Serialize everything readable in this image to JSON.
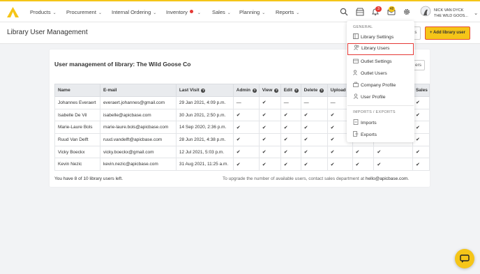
{
  "nav": {
    "items": [
      {
        "label": "Products"
      },
      {
        "label": "Procurement"
      },
      {
        "label": "Internal Ordering"
      },
      {
        "label": "Inventory"
      },
      {
        "label": "Sales"
      },
      {
        "label": "Planning"
      },
      {
        "label": "Reports"
      }
    ],
    "notifications_count": "3",
    "messages_count": "48",
    "user_name": "NICK VAN DYCK",
    "user_org": "THE WILD GOOS..."
  },
  "page": {
    "title": "Library User Management",
    "add_button": "+ Add library user",
    "card_title": "User management of library: The Wild Goose Co",
    "partial_button": "ers"
  },
  "table": {
    "headers": [
      "Name",
      "E-mail",
      "Last Visit",
      "Admin",
      "View",
      "Edit",
      "Delete",
      "Upload",
      "",
      "",
      "Sales"
    ],
    "rows": [
      {
        "name": "Johannes Everaert",
        "email": "everaert.johannes@gmail.com",
        "last_visit": "29 Jan 2021, 4:09 p.m.",
        "admin": "—",
        "view": "✔",
        "edit": "—",
        "delete": "—",
        "upload": "—",
        "c9": "",
        "c10": "",
        "sales": "✔"
      },
      {
        "name": "Isabelle De Vil",
        "email": "isabelle@apicbase.com",
        "last_visit": "30 Jun 2021, 2:50 p.m.",
        "admin": "✔",
        "view": "✔",
        "edit": "✔",
        "delete": "✔",
        "upload": "✔",
        "c9": "",
        "c10": "",
        "sales": "✔"
      },
      {
        "name": "Marie-Laure Bols",
        "email": "marie-laure.bols@apicbase.com",
        "last_visit": "14 Sep 2020, 2:36 p.m.",
        "admin": "✔",
        "view": "✔",
        "edit": "✔",
        "delete": "✔",
        "upload": "✔",
        "c9": "",
        "c10": "",
        "sales": "✔"
      },
      {
        "name": "Ruud Van Delft",
        "email": "ruud.vandelft@apicbase.com",
        "last_visit": "28 Jun 2021, 4:38 p.m.",
        "admin": "✔",
        "view": "✔",
        "edit": "✔",
        "delete": "✔",
        "upload": "✔",
        "c9": "",
        "c10": "",
        "sales": "✔"
      },
      {
        "name": "Vicky Boeckx",
        "email": "vicky.boeckx@gmail.com",
        "last_visit": "12 Jul 2021, 5:03 p.m.",
        "admin": "✔",
        "view": "✔",
        "edit": "✔",
        "delete": "✔",
        "upload": "✔",
        "c9": "✔",
        "c10": "✔",
        "sales": "✔"
      },
      {
        "name": "Kevin Nezic",
        "email": "kevin.nezic@apicbase.com",
        "last_visit": "31 Aug 2021, 11:25 a.m.",
        "admin": "✔",
        "view": "✔",
        "edit": "✔",
        "delete": "✔",
        "upload": "✔",
        "c9": "✔",
        "c10": "✔",
        "sales": "✔"
      }
    ]
  },
  "footer": {
    "users_left": "You have 8 of 10 library users left.",
    "upgrade_text": "To upgrade the number of available users, contact sales department at ",
    "email": "hello@apicbase.com."
  },
  "dropdown": {
    "general_heading": "GENERAL",
    "items_general": [
      "Library Settings",
      "Library Users",
      "Outlet Settings",
      "Outlet Users",
      "Company Profile",
      "User Profile"
    ],
    "imports_heading": "IMPORTS / EXPORTS",
    "items_io": [
      "Imports",
      "Exports"
    ]
  },
  "colors": {
    "accent": "#f5c518",
    "danger": "#e53935"
  },
  "icons": [
    "logo-icon",
    "search-icon",
    "store-icon",
    "bell-icon",
    "messages-icon",
    "gear-icon",
    "avatar-icon",
    "chat-icon"
  ]
}
